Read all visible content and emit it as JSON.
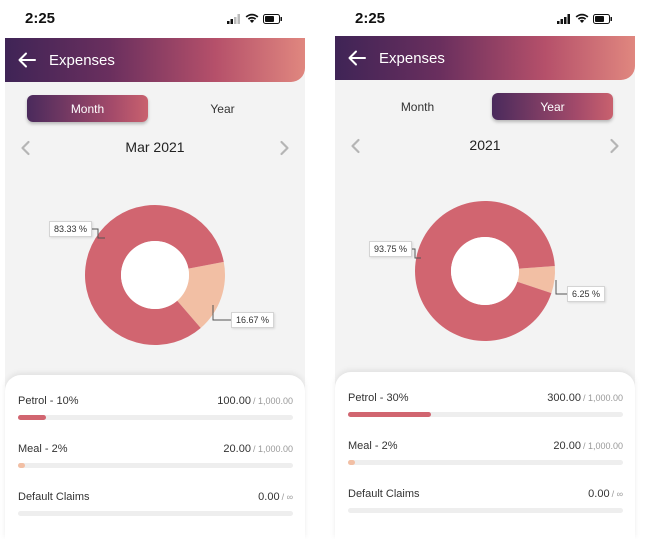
{
  "colors": {
    "petrol": "#d16570",
    "meal": "#f2bfa4",
    "default": "#e6e6e6"
  },
  "screens": [
    {
      "status_time": "2:25",
      "appbar_title": "Expenses",
      "tabs": [
        "Month",
        "Year"
      ],
      "active_tab": 0,
      "period": "Mar 2021",
      "chart_data": {
        "type": "pie",
        "donut": true,
        "slices": [
          {
            "label": "83.33 %",
            "value": 83.33,
            "color": "#d16570"
          },
          {
            "label": "16.67 %",
            "value": 16.67,
            "color": "#f2bfa4"
          }
        ]
      },
      "items": [
        {
          "label": "Petrol  - 10%",
          "amount": "100.00",
          "limit": "/ 1,000.00",
          "progress": 0.1,
          "color": "#d16570"
        },
        {
          "label": "Meal  - 2%",
          "amount": "20.00",
          "limit": "/ 1,000.00",
          "progress": 0.02,
          "color": "#f2bfa4"
        },
        {
          "label": "Default Claims",
          "amount": "0.00",
          "limit": "/ ∞",
          "progress": 0,
          "color": "#e6e6e6"
        }
      ]
    },
    {
      "status_time": "2:25",
      "appbar_title": "Expenses",
      "tabs": [
        "Month",
        "Year"
      ],
      "active_tab": 1,
      "period": "2021",
      "chart_data": {
        "type": "pie",
        "donut": true,
        "slices": [
          {
            "label": "93.75 %",
            "value": 93.75,
            "color": "#d16570"
          },
          {
            "label": "6.25 %",
            "value": 6.25,
            "color": "#f2bfa4"
          }
        ]
      },
      "items": [
        {
          "label": "Petrol  - 30%",
          "amount": "300.00",
          "limit": "/ 1,000.00",
          "progress": 0.3,
          "color": "#d16570"
        },
        {
          "label": "Meal  - 2%",
          "amount": "20.00",
          "limit": "/ 1,000.00",
          "progress": 0.02,
          "color": "#f2bfa4"
        },
        {
          "label": "Default Claims",
          "amount": "0.00",
          "limit": "/ ∞",
          "progress": 0,
          "color": "#e6e6e6"
        }
      ]
    }
  ]
}
